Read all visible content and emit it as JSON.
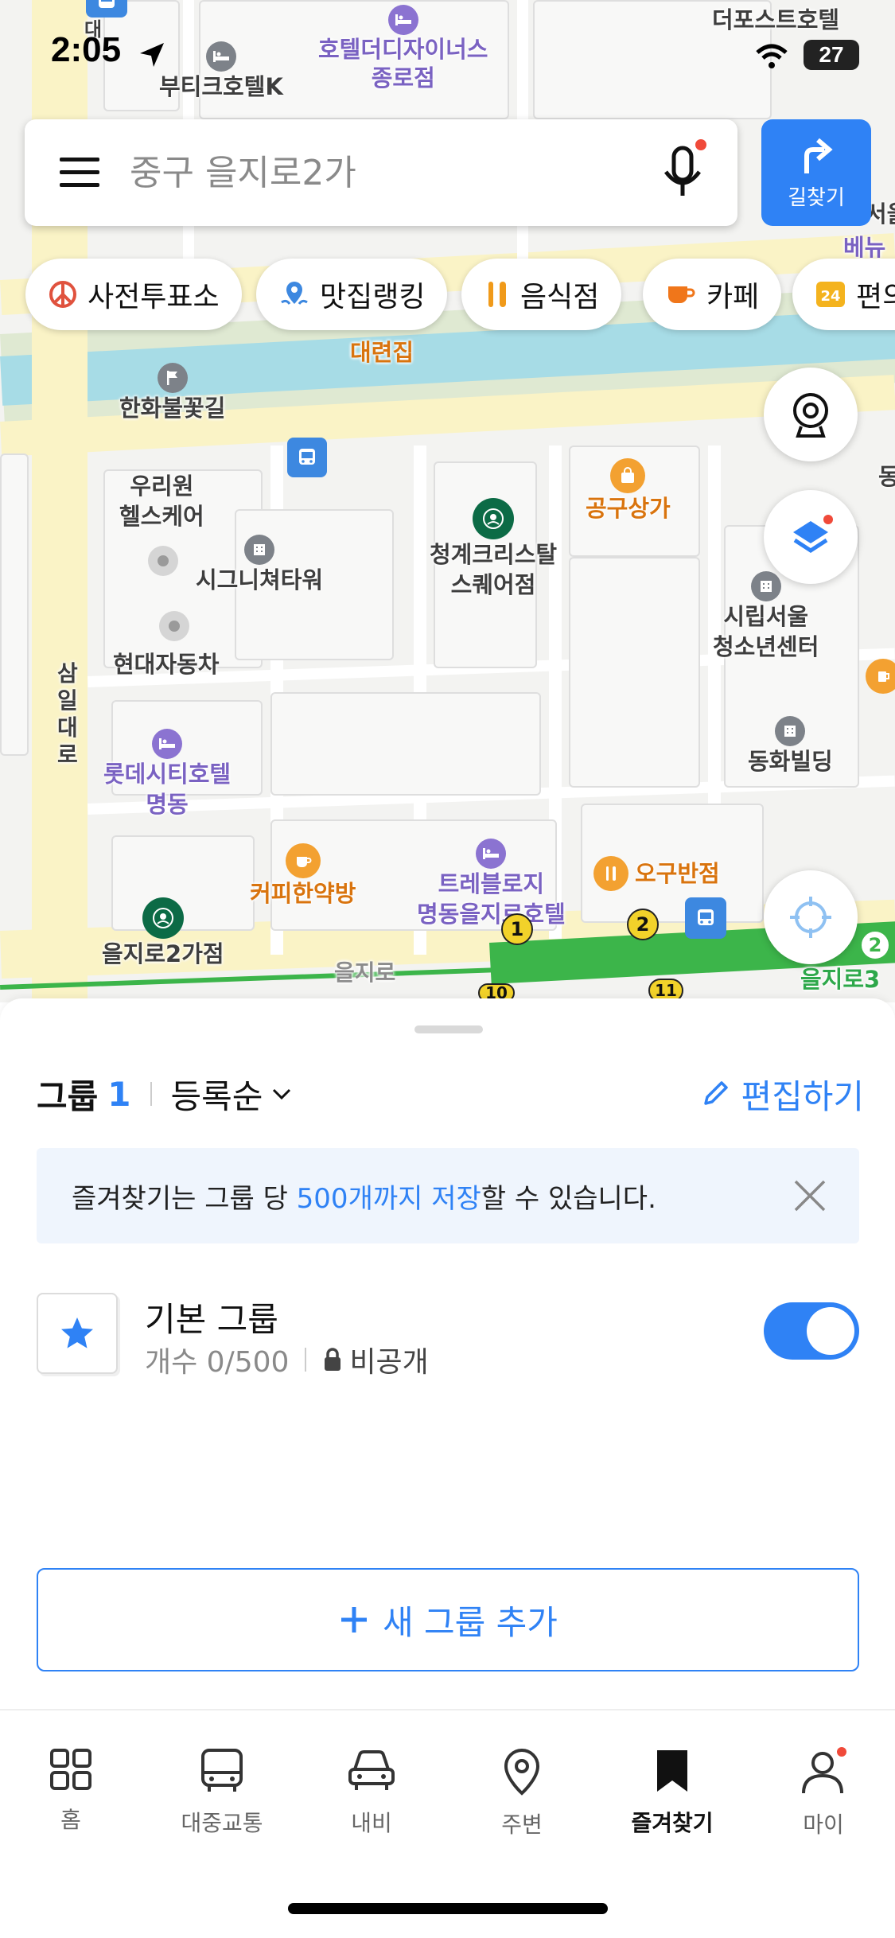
{
  "status": {
    "time": "2:05",
    "battery": "27"
  },
  "search": {
    "placeholder": "중구 을지로2가"
  },
  "route_button": {
    "label": "길찾기"
  },
  "chips": [
    {
      "label": "사전투표소",
      "icon": "vote-icon"
    },
    {
      "label": "맛집랭킹",
      "icon": "pin-icon"
    },
    {
      "label": "음식점",
      "icon": "restaurant-icon"
    },
    {
      "label": "카페",
      "icon": "coffee-icon"
    },
    {
      "label": "편의",
      "icon": "24h-icon"
    }
  ],
  "map": {
    "labels": {
      "hotel_designers": "호텔더디자이너스\n종로점",
      "boutique_hotel": "부티크호텔K",
      "the_first": "더포스트호텔",
      "daeryeon": "대련집",
      "hanwha": "한화불꽃길",
      "uriwon": "우리원\n헬스케어",
      "signature": "시그니쳐타워",
      "hyundai": "현대자동차",
      "cheonggye": "청계크리스탈\n스퀘어점",
      "gonggu": "공구상가",
      "youth_center": "시립서울\n청소년센터",
      "donghwa": "동화빌딩",
      "lotte": "롯데시티호텔\n명동",
      "coffee": "커피한약방",
      "travelodge": "트레블로지\n명동을지로호텔",
      "ogu": "오구반점",
      "euljiro2": "을지로2가점",
      "samil": "삼일대로",
      "euljiro": "을지로",
      "euljiro3": "을지로3",
      "seoul": "서울",
      "benu": "베뉴",
      "partial_dae": "대",
      "partial_dong": "동"
    },
    "subway_nums": [
      "1",
      "2",
      "2",
      "10",
      "11"
    ]
  },
  "sheet": {
    "group_label": "그룹",
    "group_count": "1",
    "sort_label": "등록순",
    "edit_label": "편집하기",
    "notice_prefix": "즐겨찾기는 그룹 당 ",
    "notice_highlight": "500개까지 저장",
    "notice_suffix": "할 수 있습니다.",
    "group": {
      "name": "기본 그룹",
      "count": "개수 0/500",
      "privacy": "비공개",
      "toggle_on": true
    },
    "add_group_label": "새 그룹 추가"
  },
  "tabs": [
    {
      "label": "홈",
      "icon": "grid-icon",
      "active": false
    },
    {
      "label": "대중교통",
      "icon": "bus-icon",
      "active": false
    },
    {
      "label": "내비",
      "icon": "car-icon",
      "active": false
    },
    {
      "label": "주변",
      "icon": "location-pin-icon",
      "active": false
    },
    {
      "label": "즐겨찾기",
      "icon": "bookmark-icon",
      "active": true
    },
    {
      "label": "마이",
      "icon": "person-icon",
      "active": false
    }
  ],
  "colors": {
    "accent": "#2f82f5",
    "road": "#faf3c6",
    "river": "#a7dce6",
    "subway_line": "#3cb54a"
  }
}
